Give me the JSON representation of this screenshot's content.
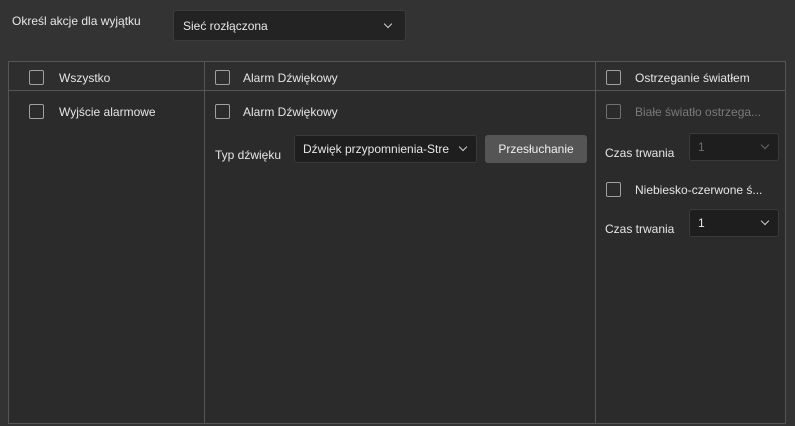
{
  "exception": {
    "label": "Określ akcje dla wyjątku",
    "selected": "Sieć rozłączona"
  },
  "columns": {
    "col1_header": "Wszystko",
    "col2_header": "Alarm Dźwiękowy",
    "col3_header": "Ostrzeganie światłem"
  },
  "col1": {
    "item": "Wyjście alarmowe"
  },
  "col2": {
    "item": "Alarm Dźwiękowy",
    "sound_type_label": "Typ dźwięku",
    "sound_type_value": "Dźwięk przypomnienia-Stre",
    "listen_button": "Przesłuchanie"
  },
  "col3": {
    "white_light": "Białe światło ostrzega...",
    "duration_label_1": "Czas trwania",
    "duration_value_1": "1",
    "blue_red": "Niebiesko-czerwone ś...",
    "duration_label_2": "Czas trwania",
    "duration_value_2": "1"
  }
}
